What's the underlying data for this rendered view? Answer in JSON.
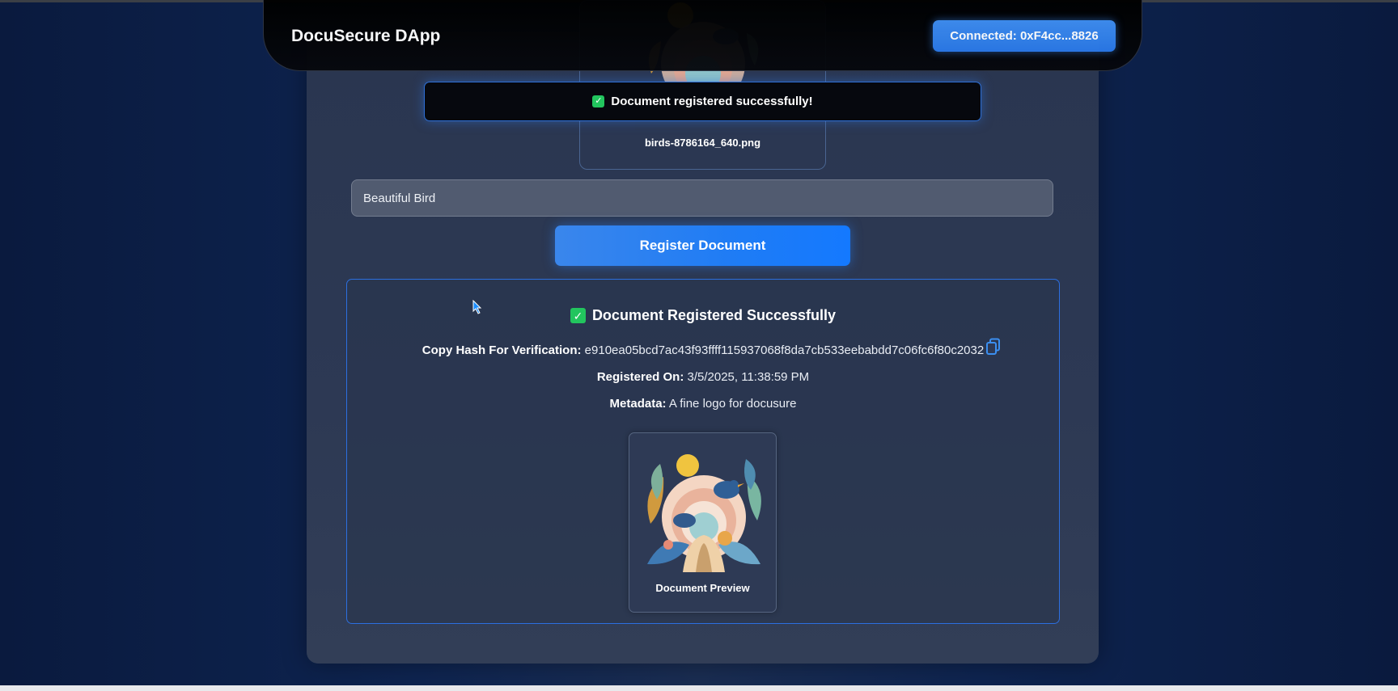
{
  "header": {
    "app_title": "DocuSecure DApp",
    "connect_label": "Connected: 0xF4cc...8826"
  },
  "upload": {
    "file_name": "birds-8786164_640.png"
  },
  "toast": {
    "message": "Document registered successfully!",
    "icon": "check-icon"
  },
  "form": {
    "metadata_value": "Beautiful Bird",
    "register_label": "Register Document"
  },
  "result": {
    "title": "Document Registered Successfully",
    "hash_label": "Copy Hash For Verification:",
    "hash_value": "e910ea05bcd7ac43f93ffff115937068f8da7cb533eebabdd7c06fc6f80c2032",
    "date_label": "Registered On:",
    "date_value": "3/5/2025, 11:38:59 PM",
    "metadata_label": "Metadata:",
    "metadata_value": "A fine logo for docusure",
    "preview_caption": "Document Preview",
    "copy_icon": "copy-icon"
  },
  "colors": {
    "accent": "#2a78e8",
    "success": "#22c55e",
    "background": "#0e2450",
    "card": "#2d3954"
  }
}
